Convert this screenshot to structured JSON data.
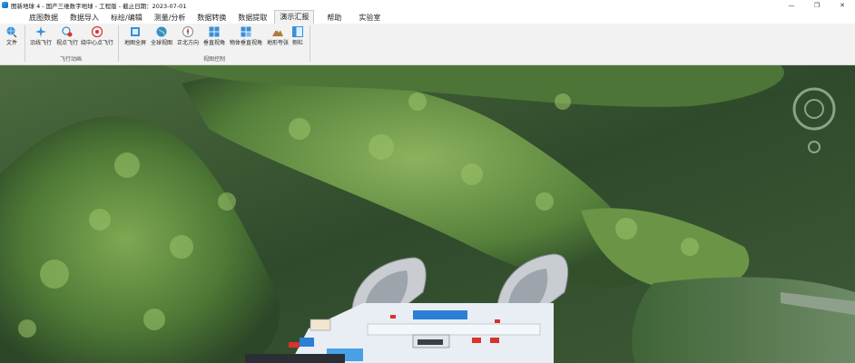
{
  "titlebar": {
    "title": "图新地球 4 - 国产三维数字地球 - 工程版 - 截止日期：2023-07-01",
    "min": "—",
    "max": "❐",
    "close": "✕"
  },
  "menu": {
    "tabs": [
      "底图数据",
      "数据导入",
      "标绘/编辑",
      "测量/分析",
      "数据转换",
      "数据提取",
      "演示汇报",
      "帮助",
      "实验室"
    ],
    "active_index": 6
  },
  "ribbon": {
    "file_label": "文件",
    "buttons": {
      "path_flight": "沿线飞行",
      "view_flight": "视点飞行",
      "orbit_flight": "绕中心点飞行",
      "map_fullscreen": "地图全屏",
      "globe_view": "全球视图",
      "north_up": "正北方向",
      "vertical_view": "垂直视角",
      "object_vertical_view": "物体垂直视角",
      "terrain_exaggeration": "地形夸张",
      "sidebar": "侧栏"
    },
    "groups": {
      "flight_animation": "飞行动画",
      "view_control": "视图控制"
    }
  },
  "colors": {
    "accent": "#2b7fd4",
    "ribbon_bg": "#f2f2f2",
    "forest_dark": "#2f4a2b",
    "forest_light": "#6f9a4a"
  }
}
